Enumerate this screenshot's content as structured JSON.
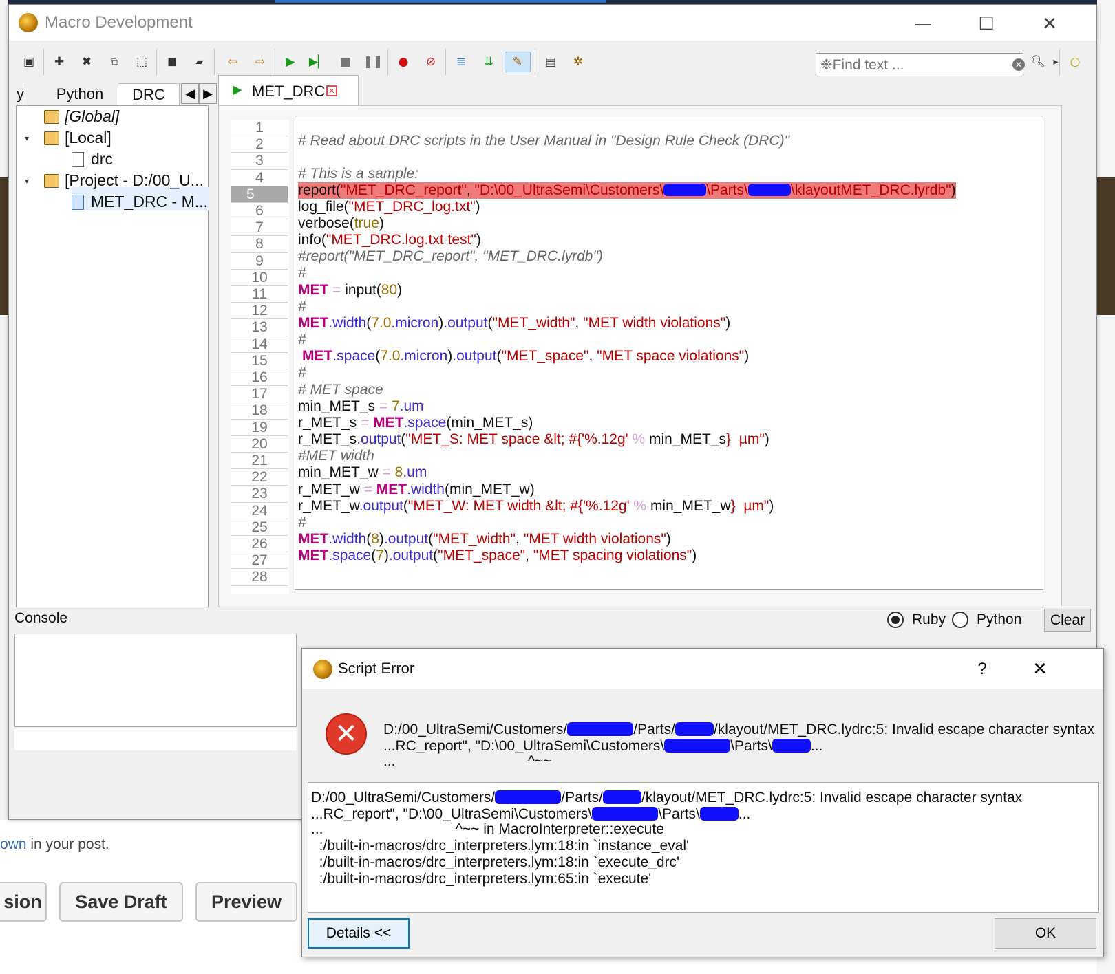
{
  "window": {
    "title": "Macro Development"
  },
  "find": {
    "placeholder": "Find text ..."
  },
  "tree_tabs": {
    "partial": "y",
    "python": "Python",
    "drc": "DRC"
  },
  "tree": {
    "global": "[Global]",
    "local": "[Local]",
    "local_child": "drc",
    "project": "[Project - D:/00_U...",
    "project_child": "MET_DRC - M..."
  },
  "editor": {
    "tab_label": "MET_DRC",
    "current_line": 5,
    "line_numbers": [
      "1",
      "2",
      "3",
      "4",
      "5",
      "6",
      "7",
      "8",
      "9",
      "10",
      "11",
      "12",
      "13",
      "14",
      "15",
      "16",
      "17",
      "18",
      "19",
      "20",
      "21",
      "22",
      "23",
      "24",
      "25",
      "26",
      "27",
      "28"
    ]
  },
  "code": {
    "l2": "# Read about DRC scripts in the User Manual in \"Design Rule Check (DRC)\"",
    "l4": "# This is a sample:",
    "l5a": "report(",
    "l5b": "\"MET_DRC_report\"",
    "l5c": ", ",
    "l5d": "\"D:\\00_UltraSemi\\Customers\\",
    "l5e": "\\Parts\\",
    "l5f": "\\klayoutMET_DRC.lyrdb\"",
    "l5g": ")",
    "l6a": "log_file(",
    "l6b": "\"MET_DRC_log.txt\"",
    "l6c": ")",
    "l7a": "verbose(",
    "l7b": "true",
    "l7c": ")",
    "l8a": "info(",
    "l8b": "\"MET_DRC.log.txt test\"",
    "l8c": ")",
    "l9": "#report(\"MET_DRC_report\", \"MET_DRC.lyrdb\")",
    "hash": "#",
    "met": "MET",
    "eq": " = ",
    "l11b": "input(",
    "l11c": "80",
    "l11d": ")",
    "width": ".width",
    "space": ".space",
    "output": ".output",
    "micron": ".micron",
    "lp": "(",
    "rp": ")",
    "comma": ", ",
    "n7_0": "7.0",
    "s_met_width": "\"MET_width\"",
    "s_met_width_viol": "\"MET width violations\"",
    "s_met_space": "\"MET_space\"",
    "s_met_space_viol": "\"MET space violations\"",
    "s_met_spacing_viol": "\"MET spacing violations\"",
    "l17": "# MET space",
    "min_met_s": "min_MET_s",
    "n7": "7",
    "um": ".um",
    "r_met_s": "r_MET_s",
    "l20s": "\"MET_S: MET space &lt; #{",
    "fmt": "'%.12g'",
    "pct": " % ",
    "l20e": "}  µm\"",
    "l21": "#MET width",
    "min_met_w": "min_MET_w",
    "n8": "8",
    "r_met_w": "r_MET_w",
    "l24s": "\"MET_W: MET width &lt; #{",
    "l24e": "}  µm\""
  },
  "console": {
    "label": "Console"
  },
  "lang": {
    "ruby": "Ruby",
    "python": "Python"
  },
  "clear_label": "Clear",
  "background": {
    "post_text_link": "own",
    "post_text_rest": " in your post.",
    "btn_partial": "sion",
    "btn_save_draft": "Save Draft",
    "btn_preview": "Preview"
  },
  "dialog": {
    "title": "Script Error",
    "help": "?",
    "msg1a": "D:/00_UltraSemi/Customers/",
    "msg1b": "/Parts/",
    "msg1c": "/klayout/MET_DRC.lydrc:5: Invalid escape character syntax",
    "msg2a": "...RC_report\", \"D:\\00_UltraSemi\\Customers\\",
    "msg2b": "\\Parts\\",
    "msg2c": "...",
    "msg3": "...                                 ^~~",
    "d1a": "D:/00_UltraSemi/Customers/",
    "d1b": "/Parts/",
    "d1c": "/klayout/MET_DRC.lydrc:5: Invalid escape character syntax",
    "d2a": "...RC_report\", \"D:\\00_UltraSemi\\Customers\\",
    "d2b": "\\Parts\\",
    "d2c": "...",
    "d3": "...                                 ^~~ in MacroInterpreter::execute",
    "d4": "  :/built-in-macros/drc_interpreters.lym:18:in `instance_eval'",
    "d5": "  :/built-in-macros/drc_interpreters.lym:18:in `execute_drc'",
    "d6": "  :/built-in-macros/drc_interpreters.lym:65:in `execute'",
    "details_label": "Details <<",
    "ok_label": "OK"
  }
}
